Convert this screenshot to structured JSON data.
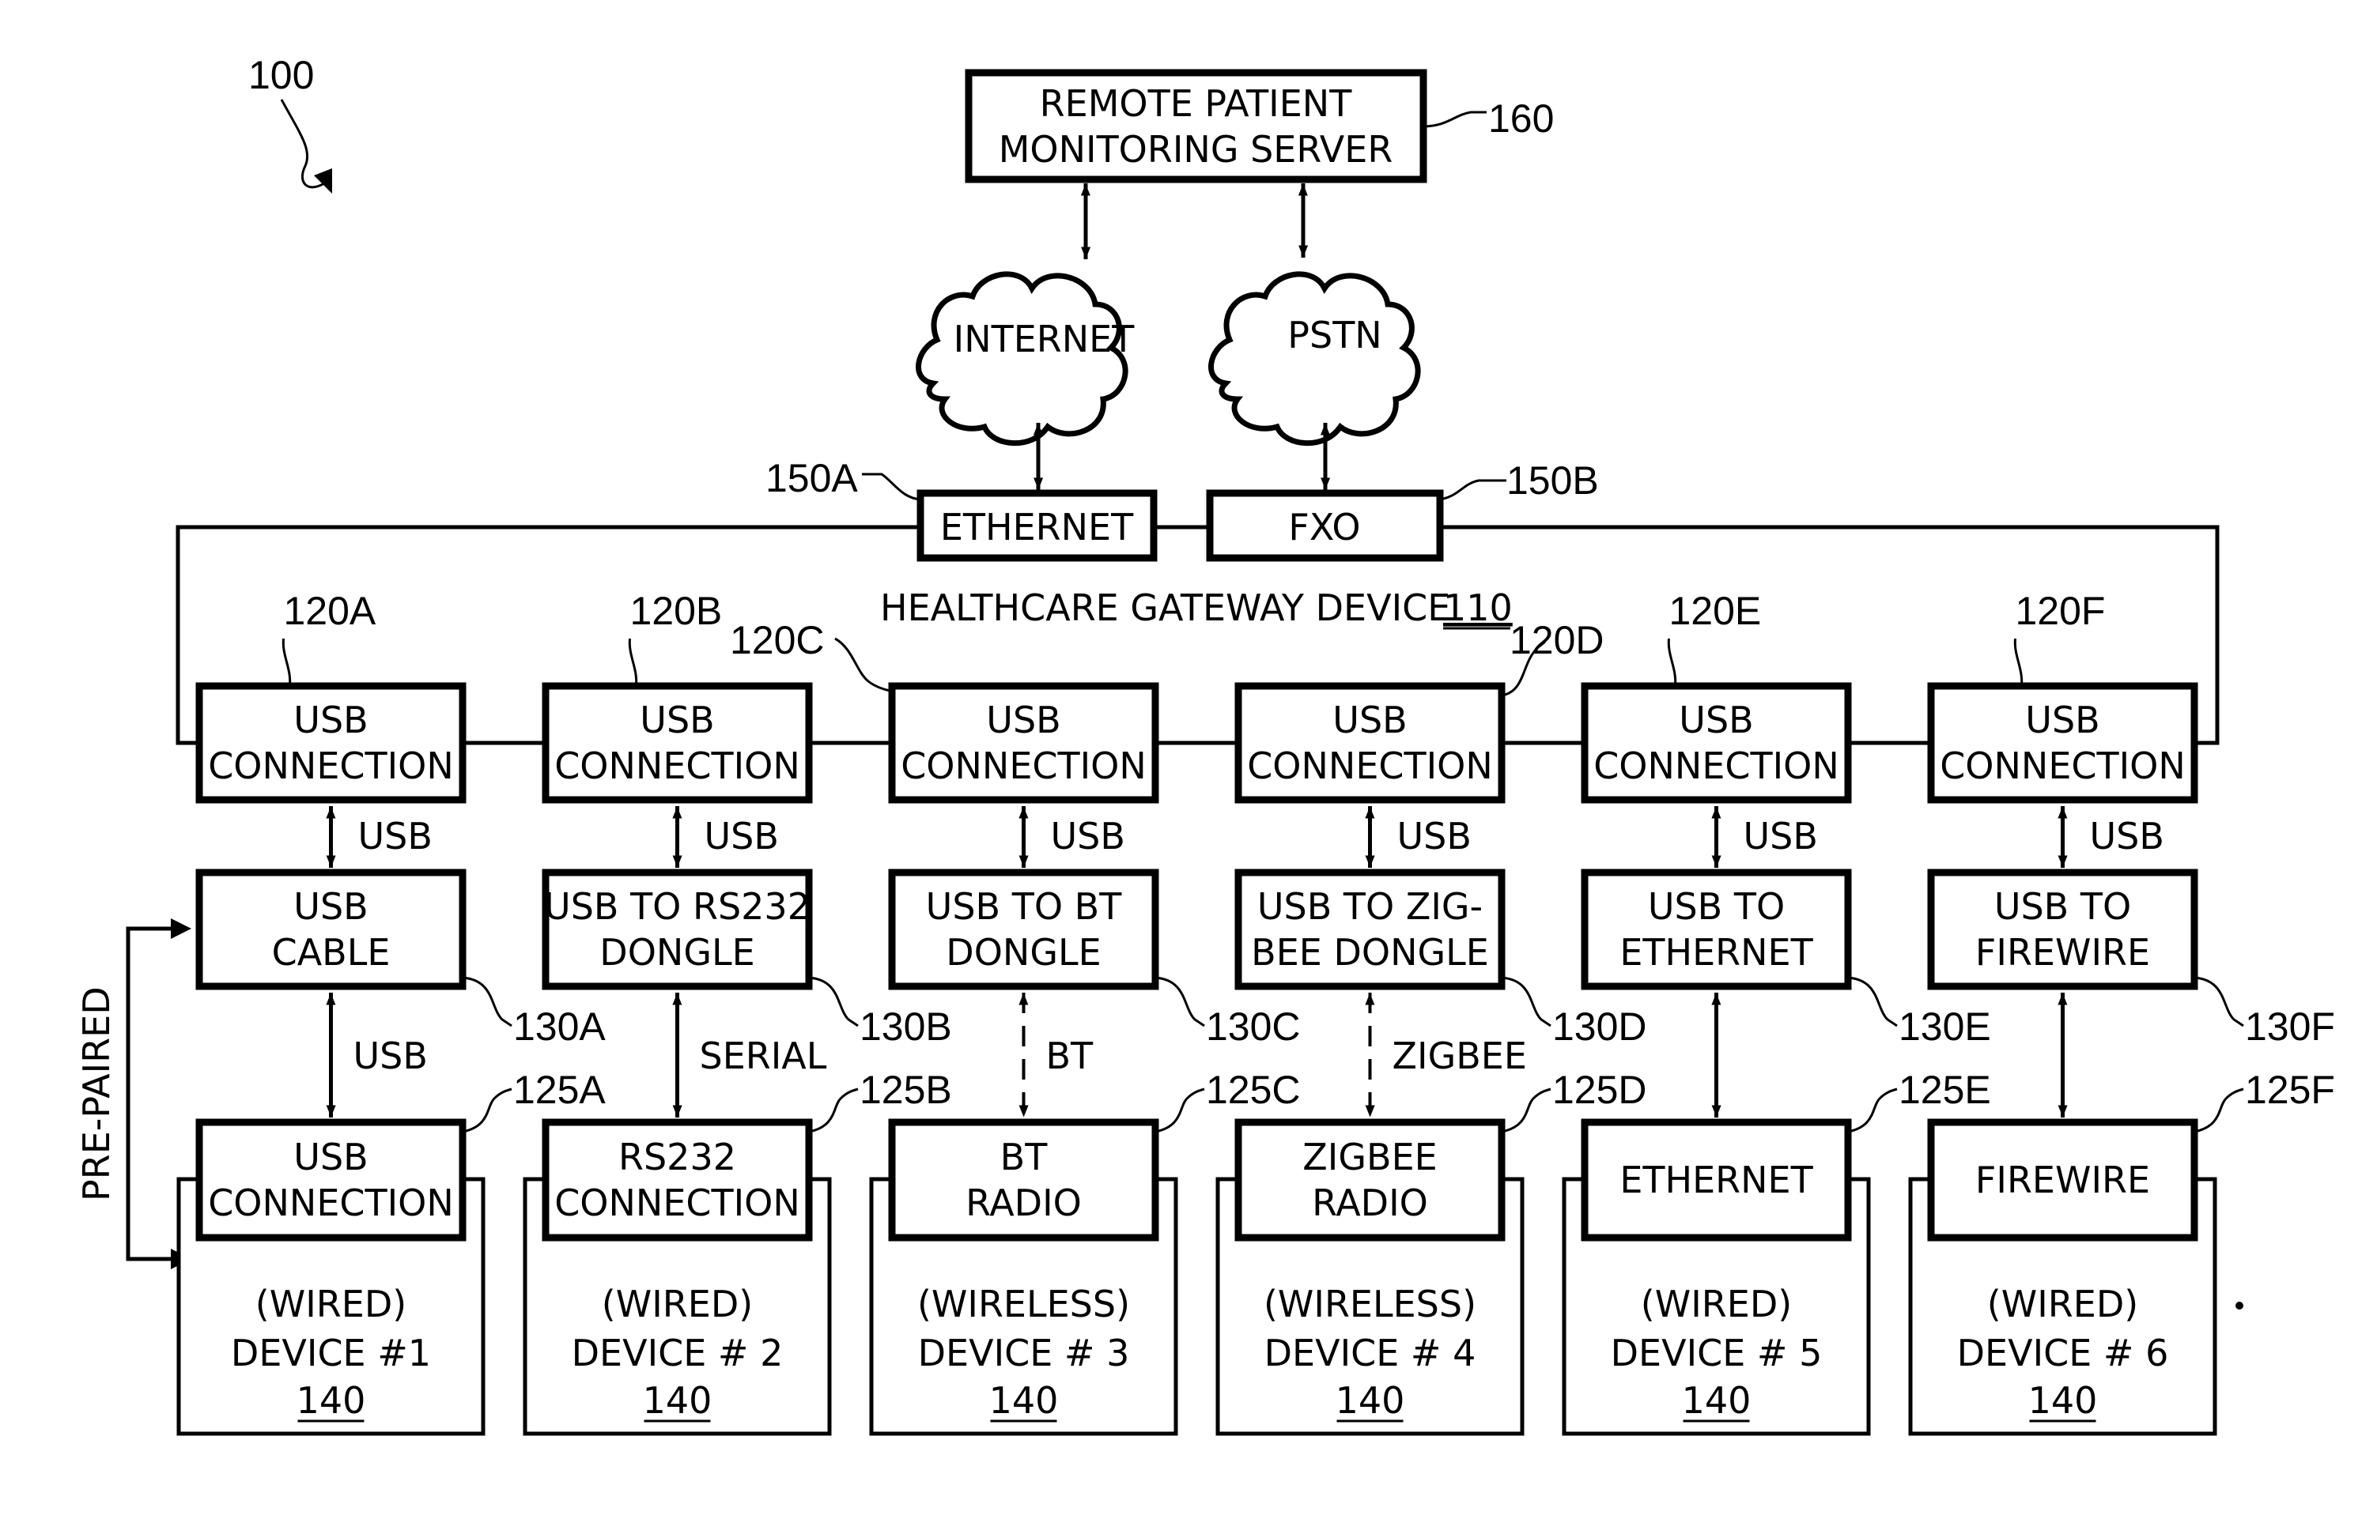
{
  "figure_ref": "100",
  "server": {
    "lines": [
      "REMOTE PATIENT",
      "MONITORING SERVER"
    ],
    "ref": "160"
  },
  "networks": [
    {
      "label": "INTERNET"
    },
    {
      "label": "PSTN"
    }
  ],
  "gateway": {
    "title": "HEALTHCARE GATEWAY DEVICE",
    "ref": "110",
    "ports": [
      {
        "label": "ETHERNET",
        "ref": "150A"
      },
      {
        "label": "FXO",
        "ref": "150B"
      }
    ]
  },
  "pre_paired_label": "PRE-PAIRED",
  "columns": [
    {
      "connection": {
        "lines": [
          "USB",
          "CONNECTION"
        ],
        "ref": "120A"
      },
      "link_top": "USB",
      "adapter": {
        "lines": [
          "USB",
          "CABLE"
        ],
        "ref": "130A"
      },
      "link_bottom": "USB",
      "link_bottom_wireless": false,
      "interface": {
        "lines": [
          "USB",
          "CONNECTION"
        ],
        "ref": "125A"
      },
      "device": {
        "lines": [
          "(WIRED)",
          "DEVICE #1"
        ],
        "ref": "140"
      }
    },
    {
      "connection": {
        "lines": [
          "USB",
          "CONNECTION"
        ],
        "ref": "120B"
      },
      "link_top": "USB",
      "adapter": {
        "lines": [
          "USB TO RS232",
          "DONGLE"
        ],
        "ref": "130B"
      },
      "link_bottom": "SERIAL",
      "link_bottom_wireless": false,
      "interface": {
        "lines": [
          "RS232",
          "CONNECTION"
        ],
        "ref": "125B"
      },
      "device": {
        "lines": [
          "(WIRED)",
          "DEVICE # 2"
        ],
        "ref": "140"
      }
    },
    {
      "connection": {
        "lines": [
          "USB",
          "CONNECTION"
        ],
        "ref": "120C"
      },
      "link_top": "USB",
      "adapter": {
        "lines": [
          "USB TO BT",
          "DONGLE"
        ],
        "ref": "130C"
      },
      "link_bottom": "BT",
      "link_bottom_wireless": true,
      "interface": {
        "lines": [
          "BT",
          "RADIO"
        ],
        "ref": "125C"
      },
      "device": {
        "lines": [
          "(WIRELESS)",
          "DEVICE # 3"
        ],
        "ref": "140"
      }
    },
    {
      "connection": {
        "lines": [
          "USB",
          "CONNECTION"
        ],
        "ref": "120D"
      },
      "link_top": "USB",
      "adapter": {
        "lines": [
          "USB TO ZIG-",
          "BEE DONGLE"
        ],
        "ref": "130D"
      },
      "link_bottom": "ZIGBEE",
      "link_bottom_wireless": true,
      "interface": {
        "lines": [
          "ZIGBEE",
          "RADIO"
        ],
        "ref": "125D"
      },
      "device": {
        "lines": [
          "(WIRELESS)",
          "DEVICE # 4"
        ],
        "ref": "140"
      }
    },
    {
      "connection": {
        "lines": [
          "USB",
          "CONNECTION"
        ],
        "ref": "120E"
      },
      "link_top": "USB",
      "adapter": {
        "lines": [
          "USB TO",
          "ETHERNET"
        ],
        "ref": "130E"
      },
      "link_bottom": "",
      "link_bottom_wireless": false,
      "interface": {
        "lines": [
          "ETHERNET"
        ],
        "ref": "125E"
      },
      "device": {
        "lines": [
          "(WIRED)",
          "DEVICE # 5"
        ],
        "ref": "140"
      }
    },
    {
      "connection": {
        "lines": [
          "USB",
          "CONNECTION"
        ],
        "ref": "120F"
      },
      "link_top": "USB",
      "adapter": {
        "lines": [
          "USB TO",
          "FIREWIRE"
        ],
        "ref": "130F"
      },
      "link_bottom": "",
      "link_bottom_wireless": false,
      "interface": {
        "lines": [
          "FIREWIRE"
        ],
        "ref": "125F"
      },
      "device": {
        "lines": [
          "(WIRED)",
          "DEVICE # 6"
        ],
        "ref": "140"
      }
    }
  ]
}
